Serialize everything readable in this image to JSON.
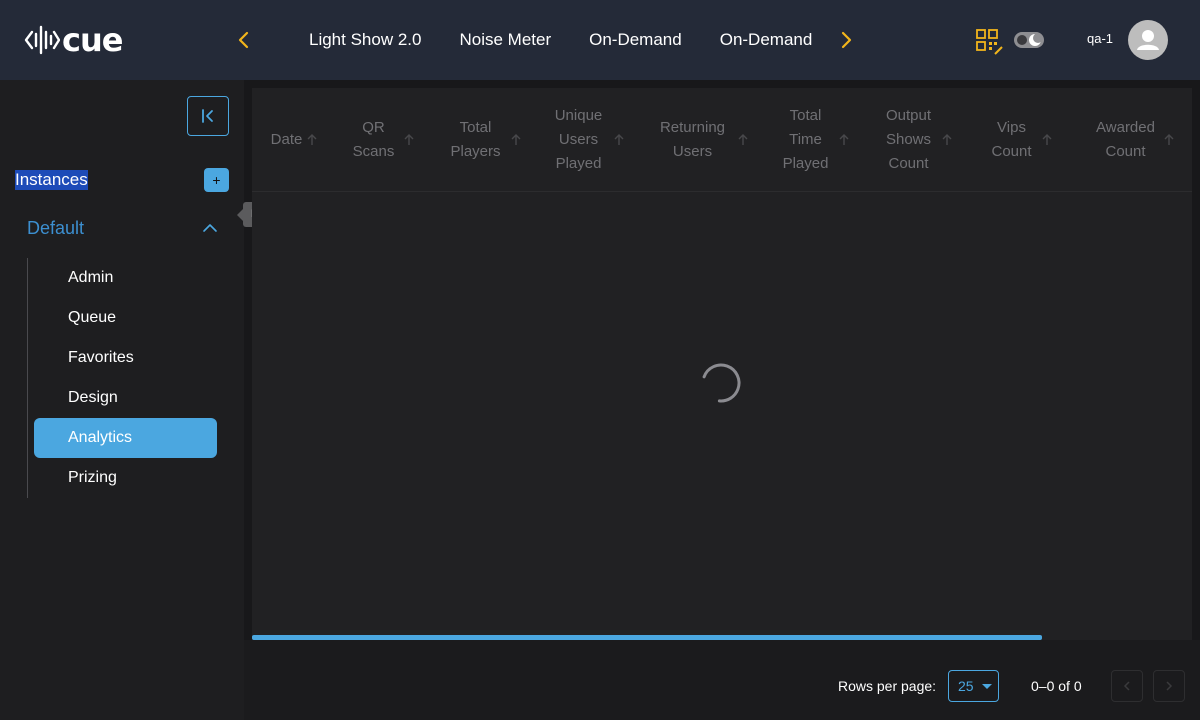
{
  "header": {
    "logo_text": "cue",
    "tabs": [
      {
        "label": "Light Show 2.0"
      },
      {
        "label": "Noise Meter"
      },
      {
        "label": "On-Demand"
      },
      {
        "label": "On-Demand"
      }
    ],
    "user_name": "qa-1",
    "accent_color": "#f2b51b",
    "icons": [
      "chevron-left-icon",
      "chevron-right-icon",
      "qr-code-icon",
      "theme-toggle-icon",
      "user-avatar-icon"
    ]
  },
  "sidebar": {
    "instances_label": "Instances",
    "add_label": "+",
    "group_title": "Default",
    "items": [
      {
        "label": "Admin",
        "active": false
      },
      {
        "label": "Queue",
        "active": false
      },
      {
        "label": "Favorites",
        "active": false
      },
      {
        "label": "Design",
        "active": false
      },
      {
        "label": "Analytics",
        "active": true
      },
      {
        "label": "Prizing",
        "active": false
      }
    ],
    "accent_color": "#4ba7e0"
  },
  "tooltip": {
    "text": "Default"
  },
  "table": {
    "columns": [
      {
        "label": "Date"
      },
      {
        "label": "QR Scans"
      },
      {
        "label": "Total Players"
      },
      {
        "label": "Unique Users Played"
      },
      {
        "label": "Returning Users"
      },
      {
        "label": "Total Time Played"
      },
      {
        "label": "Output Shows Count"
      },
      {
        "label": "Vips Count"
      },
      {
        "label": "Awarded Count"
      }
    ],
    "rows": [],
    "loading": true
  },
  "pagination": {
    "rows_per_page_label": "Rows per page:",
    "rows_per_page_value": "25",
    "range_text": "0–0 of 0"
  }
}
